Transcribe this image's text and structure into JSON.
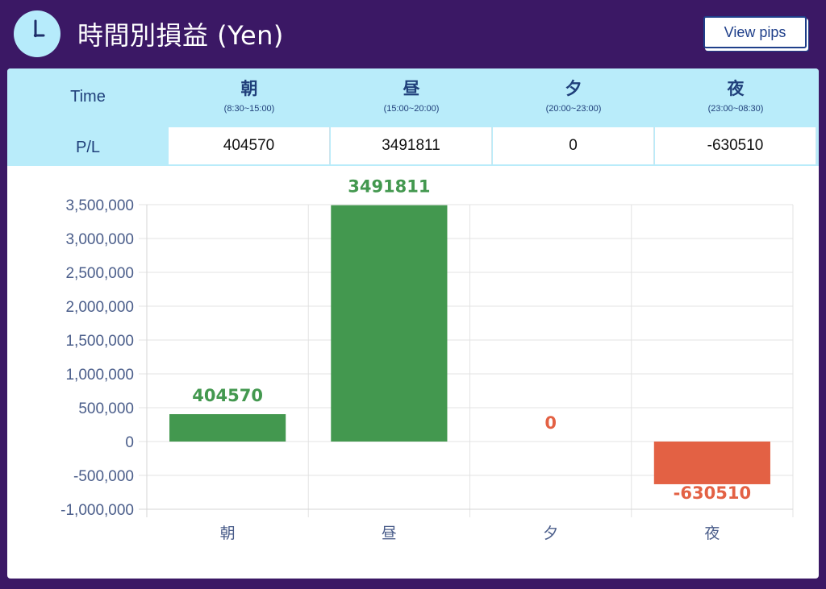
{
  "header": {
    "title": "時間別損益 (Yen)",
    "view_button_label": "View pips",
    "clock_icon": "clock-icon"
  },
  "table": {
    "time_label": "Time",
    "pl_label": "P/L",
    "columns": [
      {
        "name": "朝",
        "range": "(8:30~15:00)",
        "value": "404570"
      },
      {
        "name": "昼",
        "range": "(15:00~20:00)",
        "value": "3491811"
      },
      {
        "name": "夕",
        "range": "(20:00~23:00)",
        "value": "0"
      },
      {
        "name": "夜",
        "range": "(23:00~08:30)",
        "value": "-630510"
      }
    ]
  },
  "colors": {
    "background": "#3b1865",
    "header_cell": "#b9ecfa",
    "positive": "#43984f",
    "negative": "#e36144"
  },
  "chart_data": {
    "type": "bar",
    "categories": [
      "朝",
      "昼",
      "夕",
      "夜"
    ],
    "values": [
      404570,
      3491811,
      0,
      -630510
    ],
    "data_labels": [
      "404570",
      "3491811",
      "0",
      "-630510"
    ],
    "ylim": [
      -1000000,
      3500000
    ],
    "yticks": [
      3500000,
      3000000,
      2500000,
      2000000,
      1500000,
      1000000,
      500000,
      0,
      -500000,
      -1000000
    ],
    "ytick_labels": [
      "3,500,000",
      "3,000,000",
      "2,500,000",
      "2,000,000",
      "1,500,000",
      "1,000,000",
      "500,000",
      "0",
      "-500,000",
      "-1,000,000"
    ],
    "grid": true,
    "legend": false
  }
}
